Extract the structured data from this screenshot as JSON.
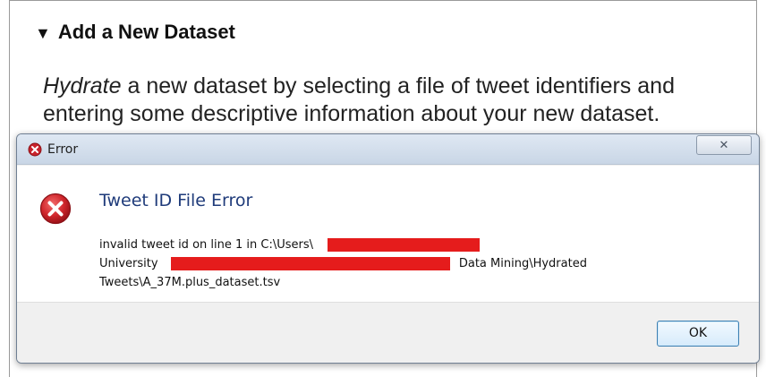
{
  "section": {
    "heading_arrow": "▼",
    "heading": "Add a New Dataset",
    "description_emphasis": "Hydrate",
    "description_rest": " a new dataset by selecting a file of tweet identifiers and entering some descriptive information about your new dataset."
  },
  "dialog": {
    "title": "Error",
    "close_label": "✕",
    "heading": "Tweet ID File Error",
    "message_line1": "invalid tweet id on line 1 in C:\\Users\\",
    "message_line2_start": "University",
    "message_line2_end": "Data Mining\\Hydrated",
    "message_line3": "Tweets\\A_37M.plus_dataset.tsv",
    "ok_label": "OK",
    "icon": "error-icon",
    "redaction_color": "#e51c1c"
  }
}
